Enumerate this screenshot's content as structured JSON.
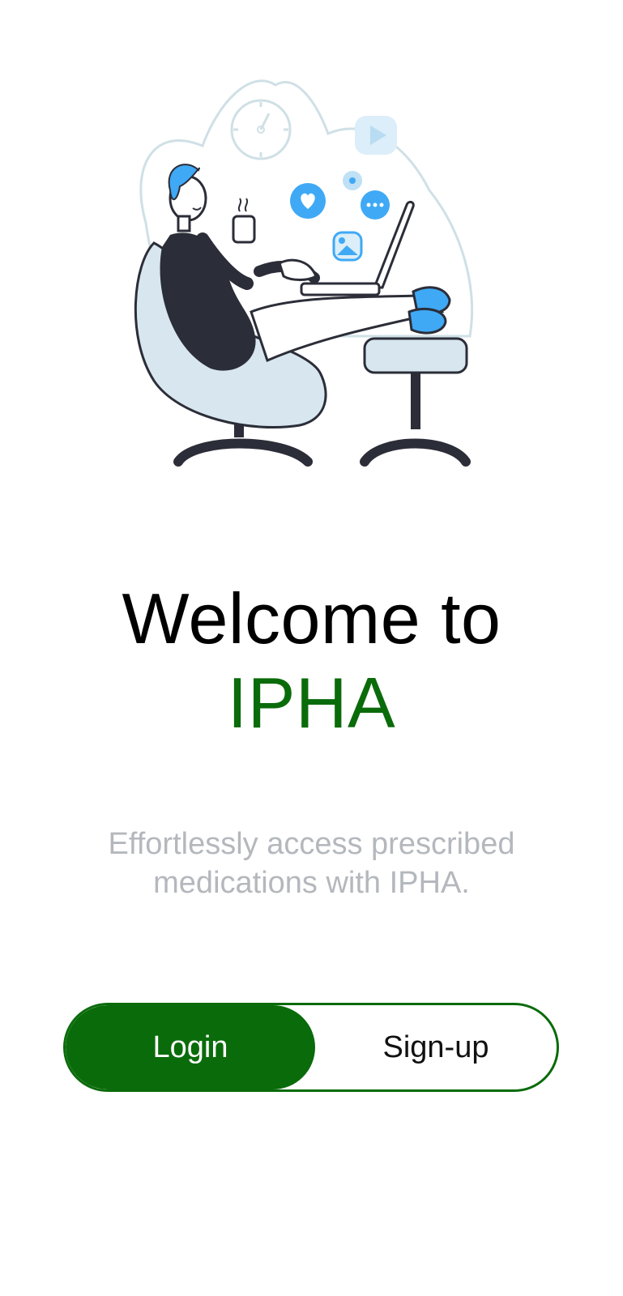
{
  "illustration": {
    "icon": "person-relaxing-with-laptop-illustration",
    "colors": {
      "accent_blue": "#3fa9f5",
      "light_blue": "#d7e6ef",
      "dark": "#2b2d38",
      "outline": "#cfe0e6"
    }
  },
  "welcome": {
    "line1": "Welcome to",
    "brand": "IPHA"
  },
  "subtitle": {
    "line1": "Effortlessly access prescribed",
    "line2": "medications with IPHA."
  },
  "auth_toggle": {
    "login_label": "Login",
    "signup_label": "Sign-up",
    "selected": "Login"
  },
  "theme": {
    "brand_green": "#0a6b0a",
    "subtitle_gray": "#b4b8bd"
  }
}
